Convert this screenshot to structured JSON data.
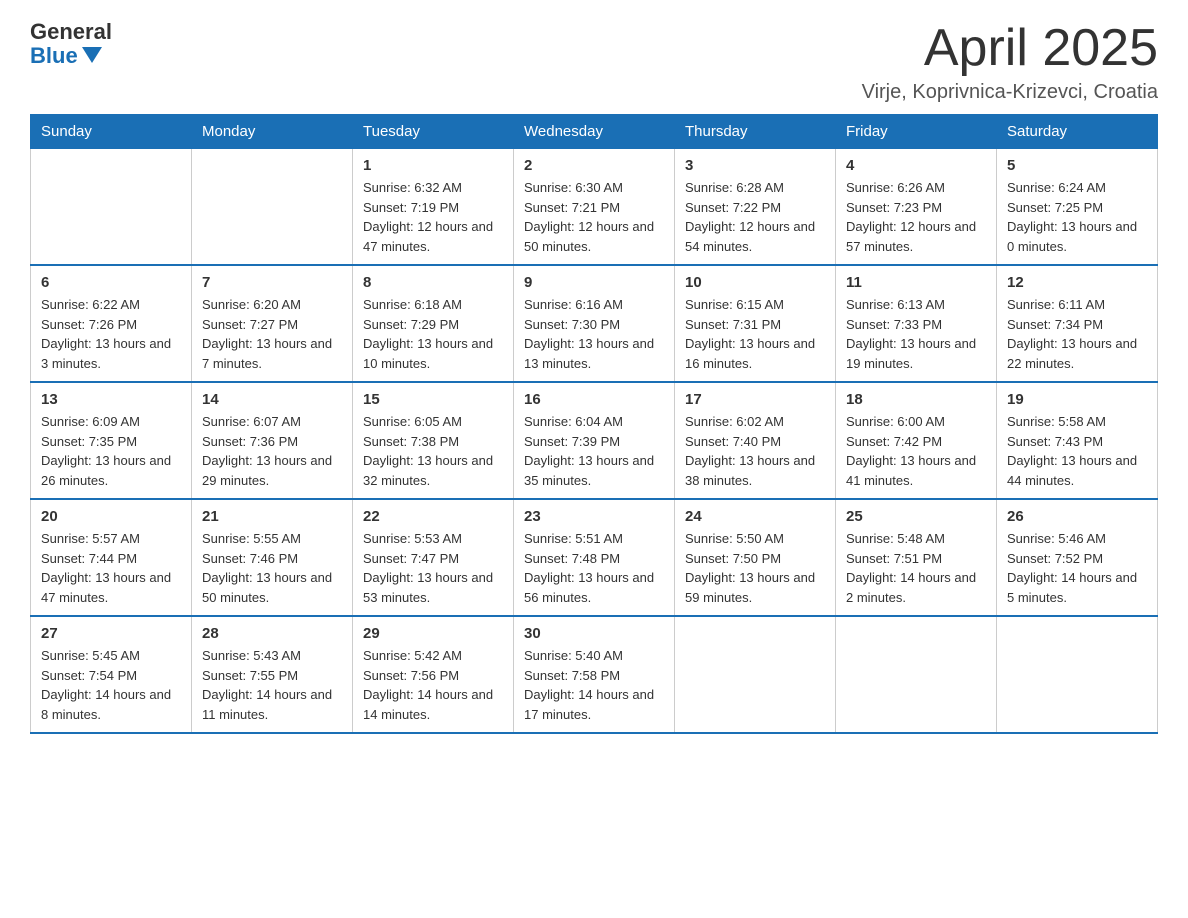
{
  "header": {
    "logo_general": "General",
    "logo_blue": "Blue",
    "title": "April 2025",
    "subtitle": "Virje, Koprivnica-Krizevci, Croatia"
  },
  "weekdays": [
    "Sunday",
    "Monday",
    "Tuesday",
    "Wednesday",
    "Thursday",
    "Friday",
    "Saturday"
  ],
  "weeks": [
    [
      {
        "day": "",
        "sunrise": "",
        "sunset": "",
        "daylight": ""
      },
      {
        "day": "",
        "sunrise": "",
        "sunset": "",
        "daylight": ""
      },
      {
        "day": "1",
        "sunrise": "Sunrise: 6:32 AM",
        "sunset": "Sunset: 7:19 PM",
        "daylight": "Daylight: 12 hours and 47 minutes."
      },
      {
        "day": "2",
        "sunrise": "Sunrise: 6:30 AM",
        "sunset": "Sunset: 7:21 PM",
        "daylight": "Daylight: 12 hours and 50 minutes."
      },
      {
        "day": "3",
        "sunrise": "Sunrise: 6:28 AM",
        "sunset": "Sunset: 7:22 PM",
        "daylight": "Daylight: 12 hours and 54 minutes."
      },
      {
        "day": "4",
        "sunrise": "Sunrise: 6:26 AM",
        "sunset": "Sunset: 7:23 PM",
        "daylight": "Daylight: 12 hours and 57 minutes."
      },
      {
        "day": "5",
        "sunrise": "Sunrise: 6:24 AM",
        "sunset": "Sunset: 7:25 PM",
        "daylight": "Daylight: 13 hours and 0 minutes."
      }
    ],
    [
      {
        "day": "6",
        "sunrise": "Sunrise: 6:22 AM",
        "sunset": "Sunset: 7:26 PM",
        "daylight": "Daylight: 13 hours and 3 minutes."
      },
      {
        "day": "7",
        "sunrise": "Sunrise: 6:20 AM",
        "sunset": "Sunset: 7:27 PM",
        "daylight": "Daylight: 13 hours and 7 minutes."
      },
      {
        "day": "8",
        "sunrise": "Sunrise: 6:18 AM",
        "sunset": "Sunset: 7:29 PM",
        "daylight": "Daylight: 13 hours and 10 minutes."
      },
      {
        "day": "9",
        "sunrise": "Sunrise: 6:16 AM",
        "sunset": "Sunset: 7:30 PM",
        "daylight": "Daylight: 13 hours and 13 minutes."
      },
      {
        "day": "10",
        "sunrise": "Sunrise: 6:15 AM",
        "sunset": "Sunset: 7:31 PM",
        "daylight": "Daylight: 13 hours and 16 minutes."
      },
      {
        "day": "11",
        "sunrise": "Sunrise: 6:13 AM",
        "sunset": "Sunset: 7:33 PM",
        "daylight": "Daylight: 13 hours and 19 minutes."
      },
      {
        "day": "12",
        "sunrise": "Sunrise: 6:11 AM",
        "sunset": "Sunset: 7:34 PM",
        "daylight": "Daylight: 13 hours and 22 minutes."
      }
    ],
    [
      {
        "day": "13",
        "sunrise": "Sunrise: 6:09 AM",
        "sunset": "Sunset: 7:35 PM",
        "daylight": "Daylight: 13 hours and 26 minutes."
      },
      {
        "day": "14",
        "sunrise": "Sunrise: 6:07 AM",
        "sunset": "Sunset: 7:36 PM",
        "daylight": "Daylight: 13 hours and 29 minutes."
      },
      {
        "day": "15",
        "sunrise": "Sunrise: 6:05 AM",
        "sunset": "Sunset: 7:38 PM",
        "daylight": "Daylight: 13 hours and 32 minutes."
      },
      {
        "day": "16",
        "sunrise": "Sunrise: 6:04 AM",
        "sunset": "Sunset: 7:39 PM",
        "daylight": "Daylight: 13 hours and 35 minutes."
      },
      {
        "day": "17",
        "sunrise": "Sunrise: 6:02 AM",
        "sunset": "Sunset: 7:40 PM",
        "daylight": "Daylight: 13 hours and 38 minutes."
      },
      {
        "day": "18",
        "sunrise": "Sunrise: 6:00 AM",
        "sunset": "Sunset: 7:42 PM",
        "daylight": "Daylight: 13 hours and 41 minutes."
      },
      {
        "day": "19",
        "sunrise": "Sunrise: 5:58 AM",
        "sunset": "Sunset: 7:43 PM",
        "daylight": "Daylight: 13 hours and 44 minutes."
      }
    ],
    [
      {
        "day": "20",
        "sunrise": "Sunrise: 5:57 AM",
        "sunset": "Sunset: 7:44 PM",
        "daylight": "Daylight: 13 hours and 47 minutes."
      },
      {
        "day": "21",
        "sunrise": "Sunrise: 5:55 AM",
        "sunset": "Sunset: 7:46 PM",
        "daylight": "Daylight: 13 hours and 50 minutes."
      },
      {
        "day": "22",
        "sunrise": "Sunrise: 5:53 AM",
        "sunset": "Sunset: 7:47 PM",
        "daylight": "Daylight: 13 hours and 53 minutes."
      },
      {
        "day": "23",
        "sunrise": "Sunrise: 5:51 AM",
        "sunset": "Sunset: 7:48 PM",
        "daylight": "Daylight: 13 hours and 56 minutes."
      },
      {
        "day": "24",
        "sunrise": "Sunrise: 5:50 AM",
        "sunset": "Sunset: 7:50 PM",
        "daylight": "Daylight: 13 hours and 59 minutes."
      },
      {
        "day": "25",
        "sunrise": "Sunrise: 5:48 AM",
        "sunset": "Sunset: 7:51 PM",
        "daylight": "Daylight: 14 hours and 2 minutes."
      },
      {
        "day": "26",
        "sunrise": "Sunrise: 5:46 AM",
        "sunset": "Sunset: 7:52 PM",
        "daylight": "Daylight: 14 hours and 5 minutes."
      }
    ],
    [
      {
        "day": "27",
        "sunrise": "Sunrise: 5:45 AM",
        "sunset": "Sunset: 7:54 PM",
        "daylight": "Daylight: 14 hours and 8 minutes."
      },
      {
        "day": "28",
        "sunrise": "Sunrise: 5:43 AM",
        "sunset": "Sunset: 7:55 PM",
        "daylight": "Daylight: 14 hours and 11 minutes."
      },
      {
        "day": "29",
        "sunrise": "Sunrise: 5:42 AM",
        "sunset": "Sunset: 7:56 PM",
        "daylight": "Daylight: 14 hours and 14 minutes."
      },
      {
        "day": "30",
        "sunrise": "Sunrise: 5:40 AM",
        "sunset": "Sunset: 7:58 PM",
        "daylight": "Daylight: 14 hours and 17 minutes."
      },
      {
        "day": "",
        "sunrise": "",
        "sunset": "",
        "daylight": ""
      },
      {
        "day": "",
        "sunrise": "",
        "sunset": "",
        "daylight": ""
      },
      {
        "day": "",
        "sunrise": "",
        "sunset": "",
        "daylight": ""
      }
    ]
  ]
}
